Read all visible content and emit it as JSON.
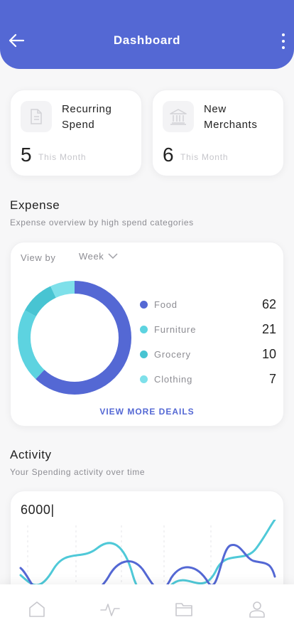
{
  "header": {
    "title": "Dashboard",
    "back_icon": "arrow-left-icon",
    "more_icon": "more-vertical-icon"
  },
  "stats": [
    {
      "label": "Recurring Spend",
      "value": "5",
      "sub": "This Month",
      "icon": "document-icon"
    },
    {
      "label": "New Merchants",
      "value": "6",
      "sub": "This Month",
      "icon": "bank-icon"
    }
  ],
  "expense": {
    "title": "Expense",
    "subtitle": "Expense overview by high spend categories",
    "view_by_label": "View by",
    "period": "Week",
    "more_link": "VIEW MORE DEAILS",
    "categories": [
      {
        "name": "Food",
        "value": "62",
        "color": "#5468d4"
      },
      {
        "name": "Furniture",
        "value": "21",
        "color": "#5dd3e0"
      },
      {
        "name": "Grocery",
        "value": "10",
        "color": "#48c4d2"
      },
      {
        "name": "Clothing",
        "value": "7",
        "color": "#7ee0ea"
      }
    ]
  },
  "activity": {
    "title": "Activity",
    "subtitle": "Your Spending activity over time",
    "max_label": "6000|",
    "series_colors": [
      "#4fc9d8",
      "#5468d4"
    ]
  },
  "nav": {
    "items": [
      "home-icon",
      "activity-icon",
      "folder-icon",
      "profile-icon"
    ]
  }
}
